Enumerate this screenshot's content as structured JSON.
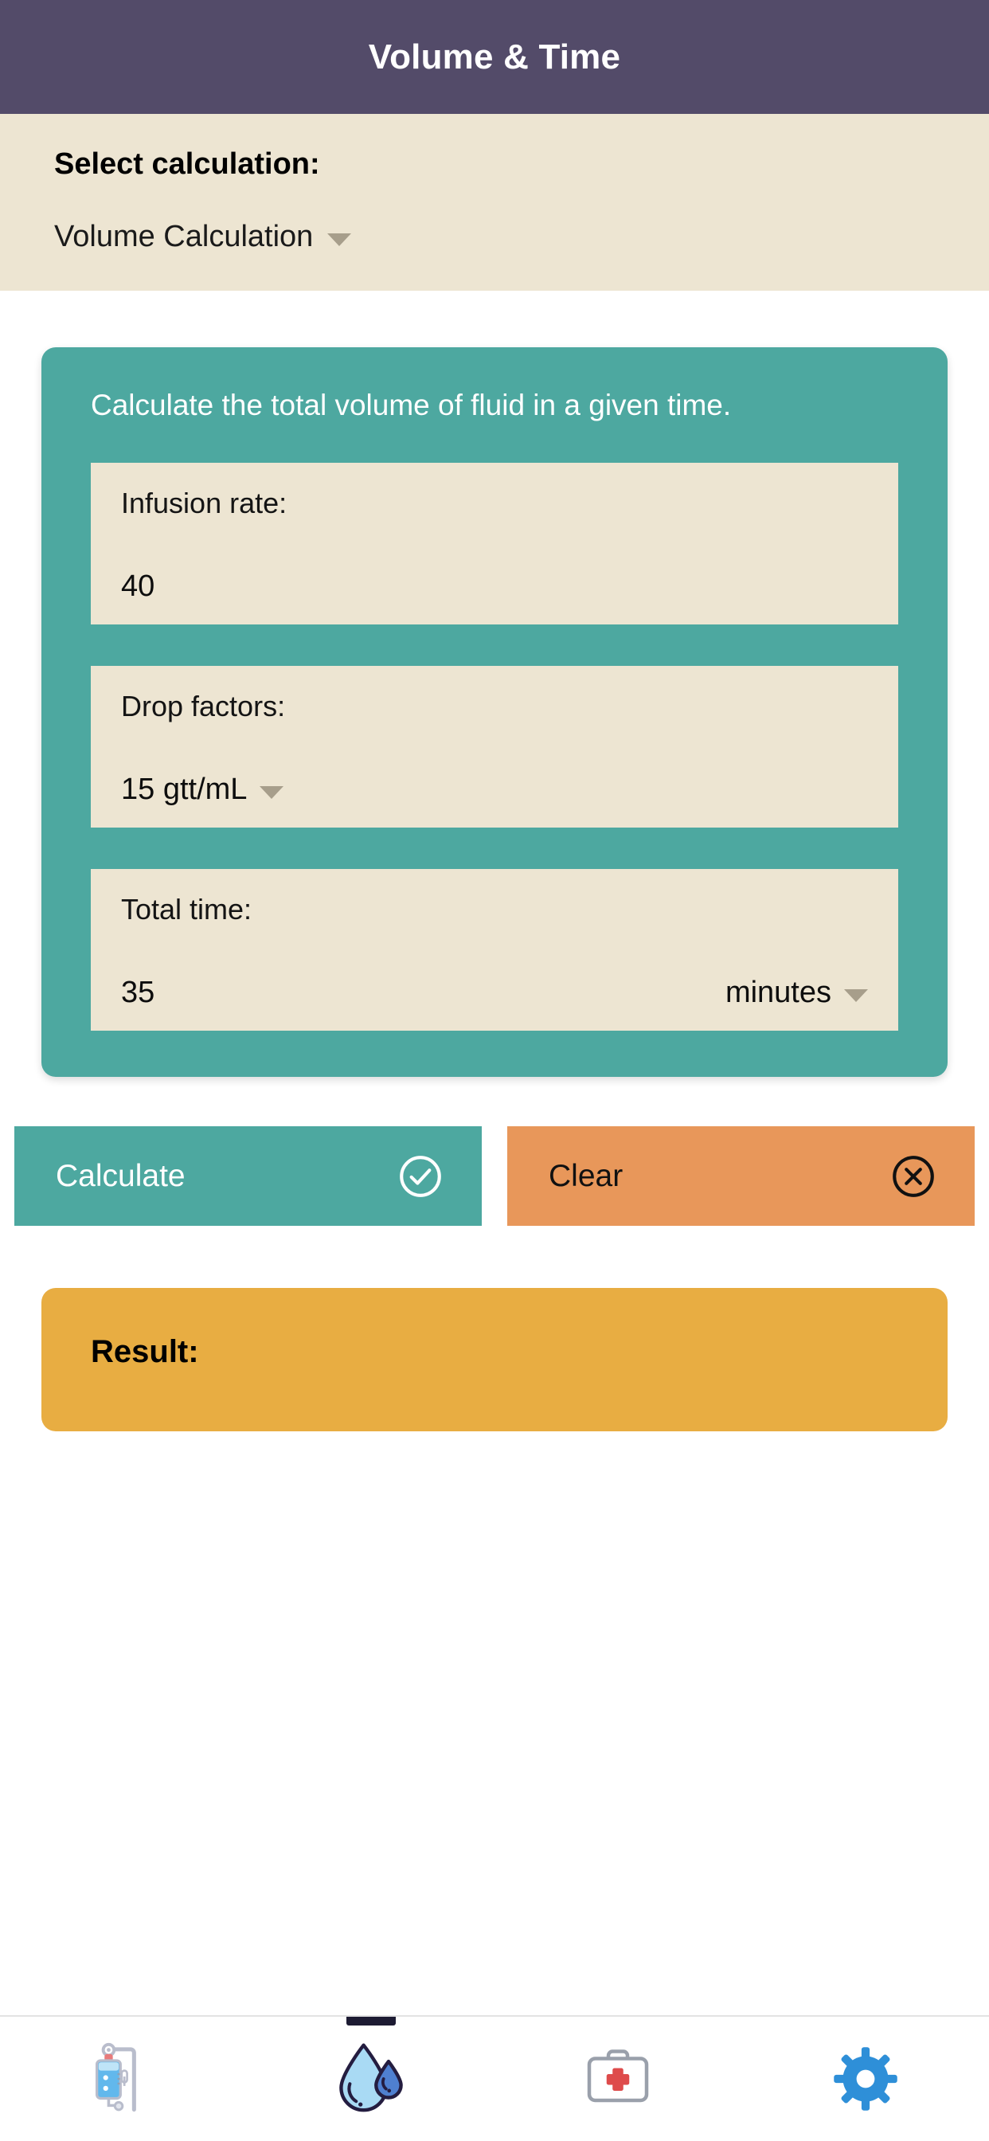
{
  "appbar": {
    "title": "Volume & Time"
  },
  "selector": {
    "label": "Select calculation:",
    "selected": "Volume Calculation",
    "caret_icon": "chevron-down-icon",
    "options": [
      "Volume Calculation"
    ]
  },
  "calc_card": {
    "description": "Calculate the total volume of fluid in a given time.",
    "fields": [
      {
        "name": "infusion-rate",
        "label": "Infusion rate:",
        "value": "40",
        "unit": "",
        "has_dropdown": false
      },
      {
        "name": "drop-factors",
        "label": "Drop factors:",
        "value": "15 gtt/mL",
        "unit": "",
        "has_dropdown": true
      },
      {
        "name": "total-time",
        "label": "Total time:",
        "value": "35",
        "unit": "minutes",
        "has_dropdown": true
      }
    ]
  },
  "actions": {
    "calculate_label": "Calculate",
    "calculate_icon": "check-circle-icon",
    "clear_label": "Clear",
    "clear_icon": "close-circle-icon"
  },
  "result": {
    "label": "Result:",
    "value": ""
  },
  "bottom_nav": {
    "items": [
      {
        "name": "iv-bag-icon",
        "active": false
      },
      {
        "name": "water-drop-icon",
        "active": true
      },
      {
        "name": "medical-kit-icon",
        "active": false
      },
      {
        "name": "gear-icon",
        "active": false
      }
    ]
  },
  "colors": {
    "appbar": "#534b69",
    "beige": "#ede5d2",
    "teal": "#4da8a0",
    "orange": "#e8975a",
    "amber": "#e8ad42",
    "white": "#ffffff",
    "caret": "#a79e8b",
    "nav_indicator": "#1d1b33"
  }
}
